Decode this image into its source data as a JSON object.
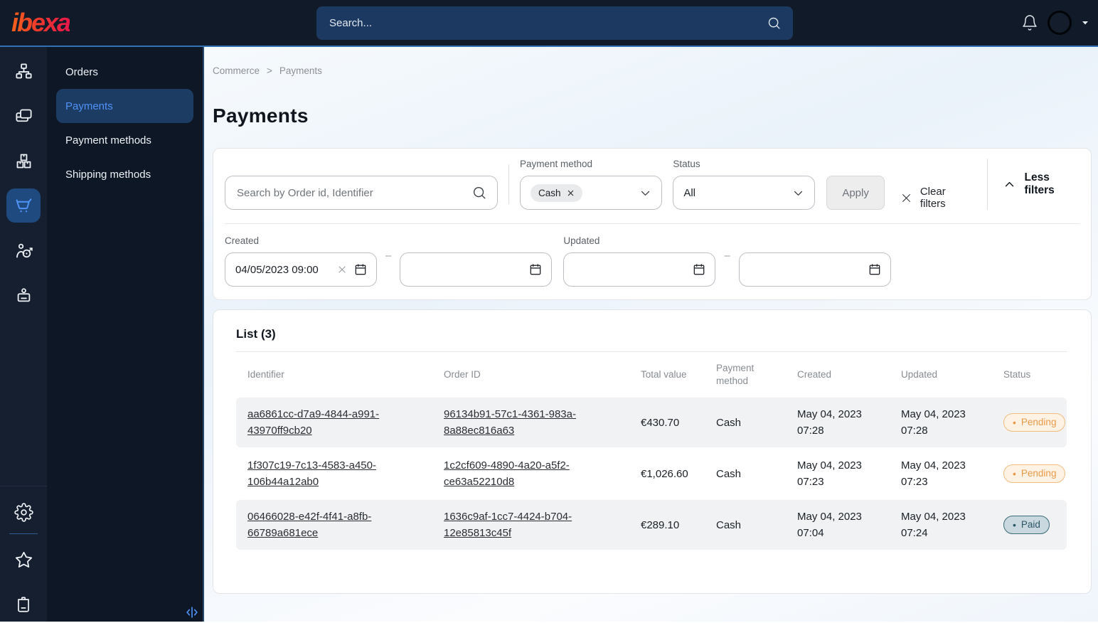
{
  "colors": {
    "accent_blue": "#4f93f7",
    "topbar_bg": "#101a29",
    "pending": "#e99a47",
    "paid": "#2b5666"
  },
  "icons": {
    "search": "magnifier",
    "bell": "notification bell",
    "calendar": "calendar grid",
    "chevron_down": "v",
    "chevron_up": "^",
    "close": "x",
    "gear": "settings cog",
    "star": "bookmarks star",
    "trash": "trash bin",
    "cart": "shopping cart",
    "resize": "<|>"
  },
  "topbar": {
    "logo_text": "ibexa",
    "search_placeholder": "Search..."
  },
  "menu": {
    "items": [
      {
        "label": "Orders"
      },
      {
        "label": "Payments"
      },
      {
        "label": "Payment methods"
      },
      {
        "label": "Shipping methods"
      }
    ],
    "active": "Payments"
  },
  "breadcrumb": {
    "items": [
      "Commerce",
      "Payments"
    ],
    "separator": ">"
  },
  "page": {
    "title": "Payments"
  },
  "filters": {
    "search_placeholder": "Search by Order id, Identifier",
    "payment_method": {
      "label": "Payment method",
      "chip": "Cash"
    },
    "status": {
      "label": "Status",
      "value": "All"
    },
    "apply_label": "Apply",
    "clear_label": "Clear filters",
    "toggle_label": "Less filters",
    "range_separator": "–",
    "created": {
      "label": "Created",
      "from": "04/05/2023 09:00",
      "to": ""
    },
    "updated": {
      "label": "Updated",
      "from": "",
      "to": ""
    }
  },
  "list": {
    "title": "List (3)",
    "columns": [
      "Identifier",
      "Order ID",
      "Total value",
      "Payment method",
      "Created",
      "Updated",
      "Status"
    ],
    "rows": [
      {
        "identifier": "aa6861cc-d7a9-4844-a991-43970ff9cb20",
        "order_id": "96134b91-57c1-4361-983a-8a88ec816a63",
        "total": "€430.70",
        "method": "Cash",
        "created": "May 04, 2023 07:28",
        "updated": "May 04, 2023 07:28",
        "status": "Pending"
      },
      {
        "identifier": "1f307c19-7c13-4583-a450-106b44a12ab0",
        "order_id": "1c2cf609-4890-4a20-a5f2-ce63a52210d8",
        "total": "€1,026.60",
        "method": "Cash",
        "created": "May 04, 2023 07:23",
        "updated": "May 04, 2023 07:23",
        "status": "Pending"
      },
      {
        "identifier": "06466028-e42f-4f41-a8fb-66789a681ece",
        "order_id": "1636c9af-1cc7-4424-b704-12e85813c45f",
        "total": "€289.10",
        "method": "Cash",
        "created": "May 04, 2023 07:04",
        "updated": "May 04, 2023 07:24",
        "status": "Paid"
      }
    ]
  }
}
